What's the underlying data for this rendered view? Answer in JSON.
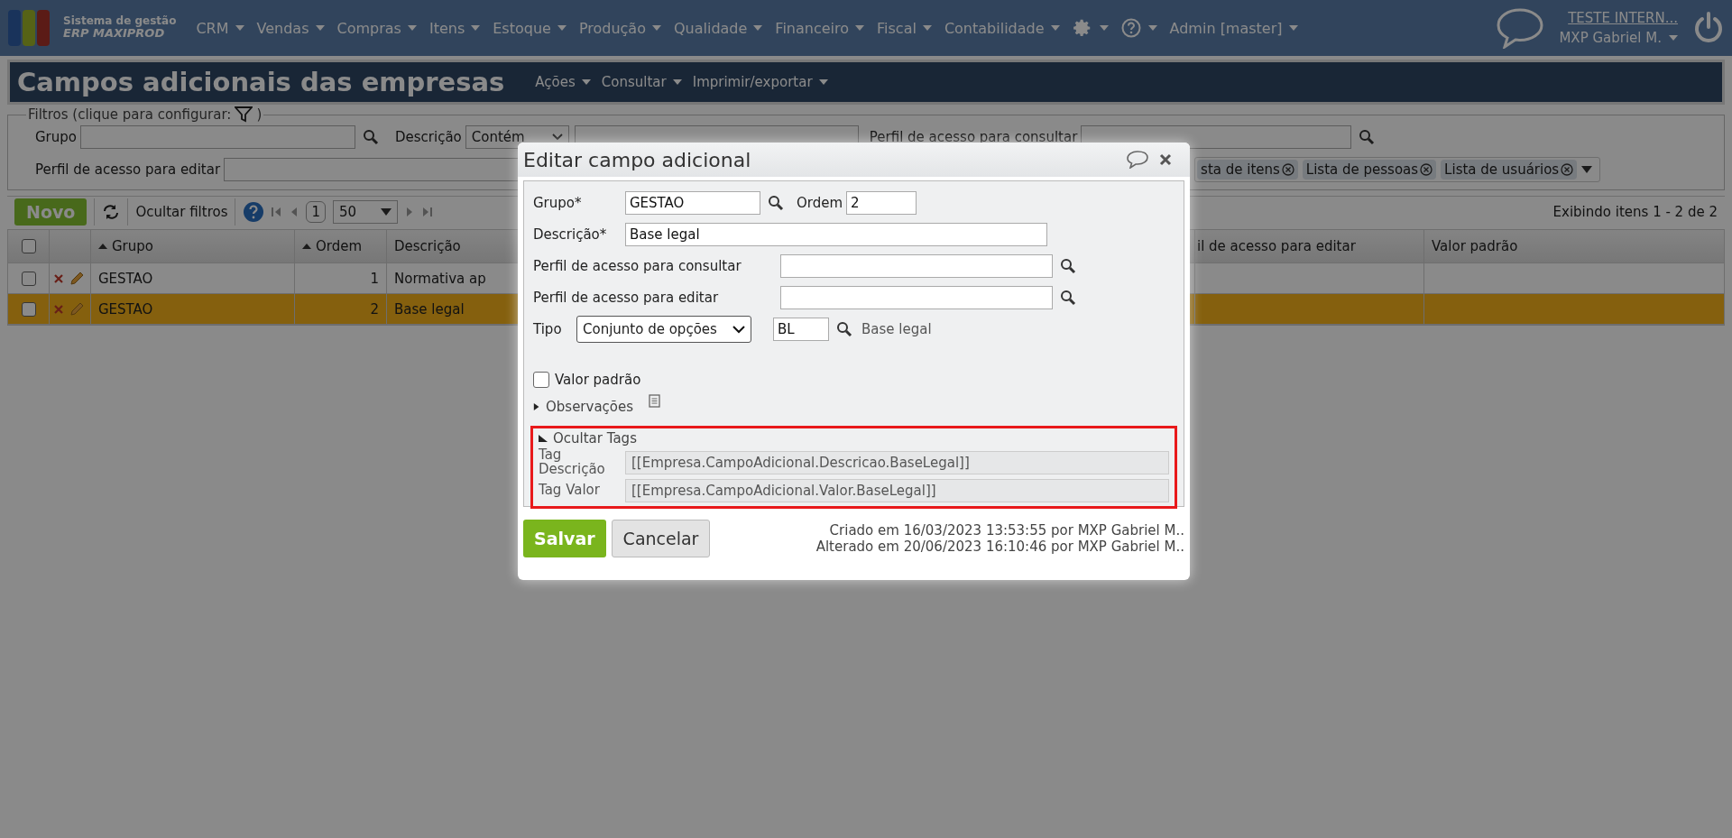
{
  "nav": {
    "logo_title": "Sistema de gestão",
    "logo_brand": "ERP MAXIPROD",
    "menus": [
      "CRM",
      "Vendas",
      "Compras",
      "Itens",
      "Estoque",
      "Produção",
      "Qualidade",
      "Financeiro",
      "Fiscal",
      "Contabilidade"
    ],
    "admin": "Admin [master]",
    "company": "TESTE INTERN...",
    "user": "MXP Gabriel M."
  },
  "page": {
    "title": "Campos adicionais das empresas",
    "menus": [
      "Ações",
      "Consultar",
      "Imprimir/exportar"
    ]
  },
  "filters": {
    "legend": "Filtros (clique para configurar:",
    "legend_close": ")",
    "grupo_label": "Grupo",
    "descricao_label": "Descrição",
    "descricao_mode": "Contém",
    "consultar_label": "Perfil de acesso para consultar",
    "editar_label": "Perfil de acesso para editar",
    "tags": [
      "sta de itens",
      "Lista de pessoas",
      "Lista de usuários"
    ]
  },
  "toolbar": {
    "new": "Novo",
    "hide_filters": "Ocultar filtros",
    "page": "1",
    "page_size": "50",
    "summary": "Exibindo itens 1 - 2 de 2"
  },
  "table": {
    "select_all_checked": false,
    "columns": [
      {
        "label": "Grupo",
        "sorted": true
      },
      {
        "label": "Ordem",
        "sorted": true
      },
      {
        "label": "Descrição",
        "sorted": false
      },
      {
        "label": "il de acesso para editar",
        "sorted": false
      },
      {
        "label": "Valor padrão",
        "sorted": false
      }
    ],
    "rows": [
      {
        "grupo": "GESTAO",
        "ordem": "1",
        "descricao": "Normativa ap",
        "checked": false,
        "selected": false
      },
      {
        "grupo": "GESTAO",
        "ordem": "2",
        "descricao": "Base legal",
        "checked": false,
        "selected": true
      }
    ]
  },
  "dialog": {
    "title": "Editar campo adicional",
    "grupo_label": "Grupo*",
    "grupo": "GESTAO",
    "ordem_label": "Ordem",
    "ordem": "2",
    "descricao_label": "Descrição*",
    "descricao": "Base legal",
    "consultar_label": "Perfil de acesso para consultar",
    "editar_label": "Perfil de acesso para editar",
    "tipo_label": "Tipo",
    "tipo": "Conjunto de opções",
    "tipo_code": "BL",
    "tipo_name": "Base legal",
    "default_label": "Valor padrão",
    "default_checked": false,
    "notes": {
      "label": "Observações",
      "expanded": false
    },
    "tags": {
      "label": "Ocultar Tags",
      "expanded": true,
      "highlighted": true,
      "items": [
        {
          "label": "Tag Descrição",
          "value": "[[Empresa.CampoAdicional.Descricao.BaseLegal]]"
        },
        {
          "label": "Tag Valor",
          "value": "[[Empresa.CampoAdicional.Valor.BaseLegal]]"
        }
      ]
    },
    "save": "Salvar",
    "cancel": "Cancelar",
    "created": "Criado em 16/03/2023 13:53:55 por MXP Gabriel M..",
    "altered": "Alterado em 20/06/2023 16:10:46 por MXP Gabriel M.."
  }
}
